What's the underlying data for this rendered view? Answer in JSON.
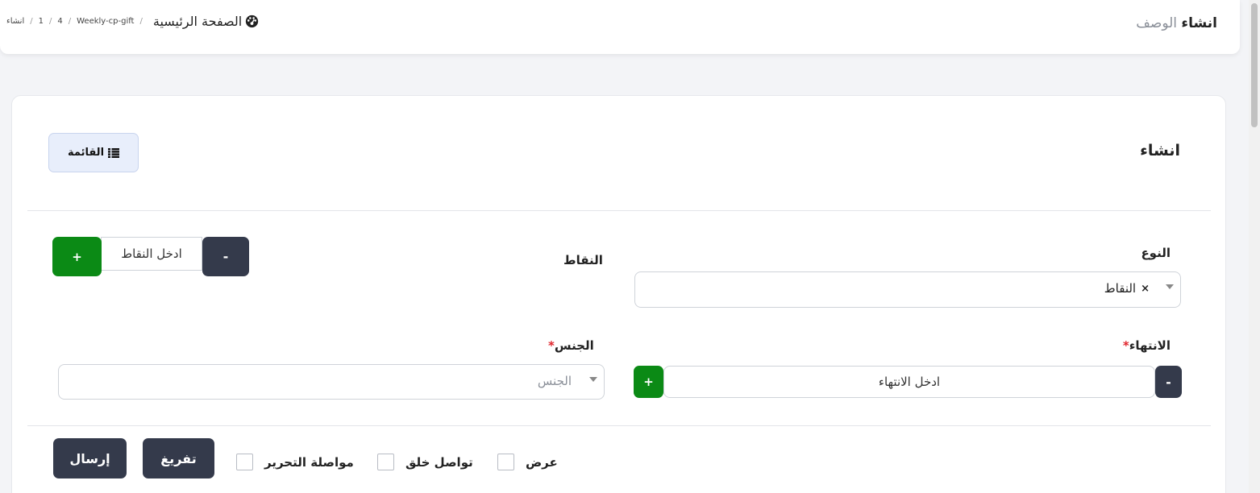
{
  "header": {
    "title": "انشاء",
    "subtitle": "الوصف",
    "breadcrumb": {
      "home_label": "الصفحة الرئيسية",
      "items": [
        "Weekly-cp-gift",
        "4",
        "1",
        "انشاء"
      ]
    }
  },
  "card": {
    "title": "انشاء",
    "list_button_label": "القائمة"
  },
  "form": {
    "type": {
      "label": "النوع",
      "selected": "النقاط",
      "remove_symbol": "×"
    },
    "points": {
      "label": "النقاط",
      "placeholder": "ادخل النقاط",
      "minus": "-",
      "plus": "+"
    },
    "end": {
      "label": "الانتهاء",
      "required_mark": "*",
      "placeholder": "ادخل الانتهاء",
      "minus": "-",
      "plus": "+"
    },
    "gender": {
      "label": "الجنس",
      "required_mark": "*",
      "placeholder": "الجنس"
    }
  },
  "actions": {
    "submit_label": "إرسال",
    "clear_label": "تفريغ",
    "checkboxes": {
      "continue_editing": "مواصلة التحرير",
      "continue_creating": "تواصل خلق",
      "view": "عرض"
    }
  },
  "colors": {
    "dark_button": "#343a4b",
    "green_button": "#0b8a15",
    "required": "#e0242b"
  }
}
